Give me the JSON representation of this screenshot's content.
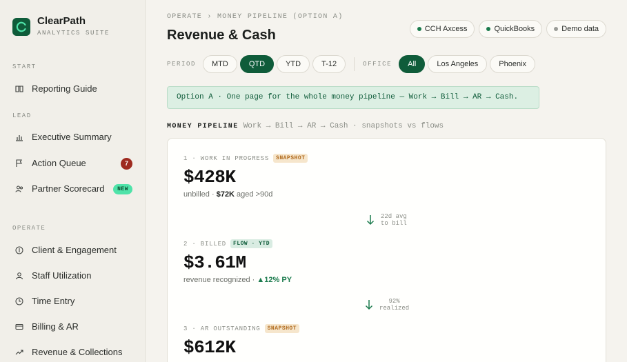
{
  "brand": {
    "name": "ClearPath",
    "subtitle": "ANALYTICS SUITE"
  },
  "sidebar": {
    "sections": [
      {
        "label": "START",
        "items": [
          {
            "label": "Reporting Guide",
            "icon": "book-icon"
          }
        ]
      },
      {
        "label": "LEAD",
        "items": [
          {
            "label": "Executive Summary",
            "icon": "bar-chart-icon"
          },
          {
            "label": "Action Queue",
            "icon": "flag-icon",
            "badge": "7"
          },
          {
            "label": "Partner Scorecard",
            "icon": "users-icon",
            "badge": "NEW"
          }
        ]
      },
      {
        "label": "OPERATE",
        "items": [
          {
            "label": "Client & Engagement",
            "icon": "dollar-circle-icon"
          },
          {
            "label": "Staff Utilization",
            "icon": "user-icon"
          },
          {
            "label": "Time Entry",
            "icon": "clock-icon"
          },
          {
            "label": "Billing & AR",
            "icon": "card-icon"
          },
          {
            "label": "Revenue & Collections",
            "icon": "trend-icon"
          }
        ]
      }
    ]
  },
  "header": {
    "breadcrumb": "OPERATE › MONEY PIPELINE (OPTION A)",
    "title": "Revenue & Cash",
    "integrations": [
      {
        "label": "CCH Axcess",
        "status_color": "#1a7a4c"
      },
      {
        "label": "QuickBooks",
        "status_color": "#1a7a4c"
      },
      {
        "label": "Demo data",
        "status_color": "#9a9c97"
      }
    ]
  },
  "filters": {
    "period_label": "PERIOD",
    "periods": [
      "MTD",
      "QTD",
      "YTD",
      "T-12"
    ],
    "period_selected": "QTD",
    "office_label": "OFFICE",
    "offices": [
      "All",
      "Los Angeles",
      "Phoenix"
    ],
    "office_selected": "All"
  },
  "banner": "Option A · One page for the whole money pipeline — Work → Bill → AR → Cash.",
  "pipeline": {
    "title": "MONEY PIPELINE",
    "subtitle": "Work → Bill → AR → Cash · snapshots vs flows",
    "stages": [
      {
        "label": "1 · WORK IN PROGRESS",
        "tag": "SNAPSHOT",
        "value": "$428K",
        "note_pre": "unbilled · ",
        "note_bold": "$72K",
        "note_post": " aged >90d"
      },
      {
        "label": "2 · BILLED",
        "tag": "FLOW · YTD",
        "value": "$3.61M",
        "note_pre": "revenue recognized · ",
        "note_up": "▲12% PY"
      },
      {
        "label": "3 · AR OUTSTANDING",
        "tag": "SNAPSHOT",
        "value": "$612K"
      }
    ],
    "transitions": [
      {
        "line1": "22d avg",
        "line2": "to bill"
      },
      {
        "line1": "92%",
        "line2": "realized"
      }
    ]
  },
  "colors": {
    "accent": "#0f5c3a",
    "badge_red": "#9e2a1f",
    "new_badge": "#4fe3a9"
  }
}
